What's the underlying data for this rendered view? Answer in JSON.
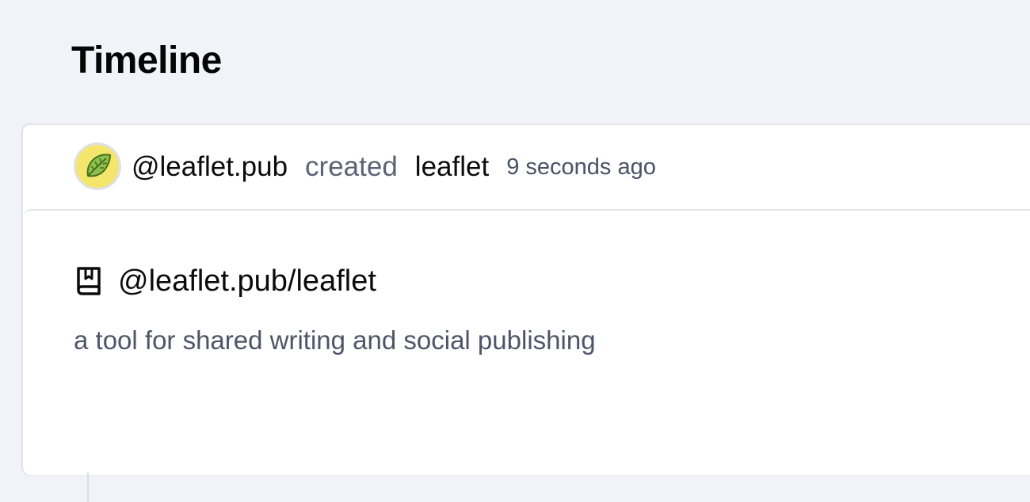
{
  "page": {
    "title": "Timeline"
  },
  "event": {
    "avatar_icon": "leaf-icon",
    "actor": "@leaflet.pub",
    "verb": "created",
    "object": "leaflet",
    "time": "9 seconds ago"
  },
  "publication": {
    "icon": "book-bookmark-icon",
    "name": "@leaflet.pub/leaflet",
    "description": "a tool for shared writing and social publishing"
  },
  "colors": {
    "background": "#f1f3f8",
    "card": "#ffffff",
    "avatar_fill": "#f4e56d",
    "leaf_green": "#8bc34a"
  }
}
